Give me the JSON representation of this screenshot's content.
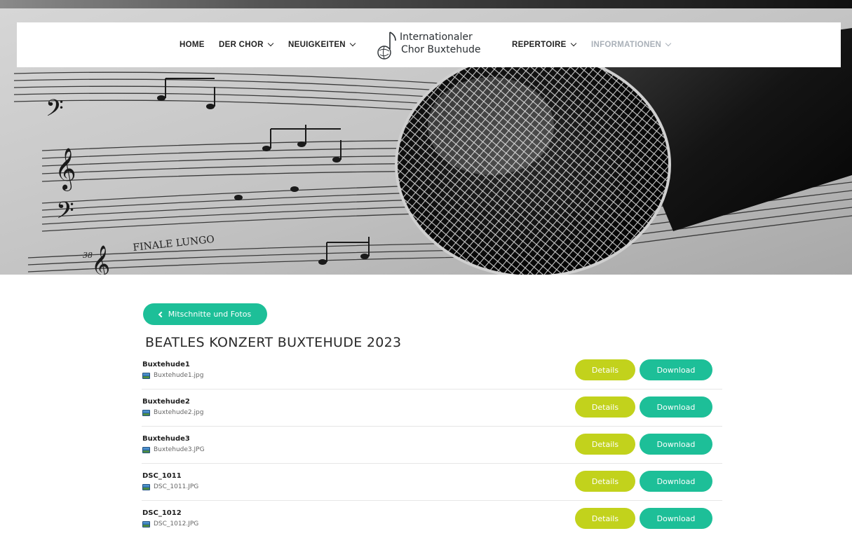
{
  "nav": {
    "home": "HOME",
    "der_chor": "DER CHOR",
    "neuigkeiten": "NEUIGKEITEN",
    "repertoire": "REPERTOIRE",
    "informationen": "INFORMATIONEN"
  },
  "logo": {
    "line1": "Internationaler",
    "line2": "Chor Buxtehude"
  },
  "hero_image": {
    "sheet_text": "FINALE LUNGO",
    "bar_number": "38"
  },
  "back_button": {
    "label": "Mitschnitte und Fotos"
  },
  "page_title": "BEATLES KONZERT BUXTEHUDE 2023",
  "files": [
    {
      "name": "Buxtehude1",
      "filename": "Buxtehude1.jpg",
      "details": "Details",
      "download": "Download"
    },
    {
      "name": "Buxtehude2",
      "filename": "Buxtehude2.jpg",
      "details": "Details",
      "download": "Download"
    },
    {
      "name": "Buxtehude3",
      "filename": "Buxtehude3.JPG",
      "details": "Details",
      "download": "Download"
    },
    {
      "name": "DSC_1011",
      "filename": "DSC_1011.JPG",
      "details": "Details",
      "download": "Download"
    },
    {
      "name": "DSC_1012",
      "filename": "DSC_1012.JPG",
      "details": "Details",
      "download": "Download"
    }
  ],
  "colors": {
    "accent_green": "#1dbf98",
    "details_lime": "#c2d21c",
    "nav_muted": "#a9b0b8"
  }
}
